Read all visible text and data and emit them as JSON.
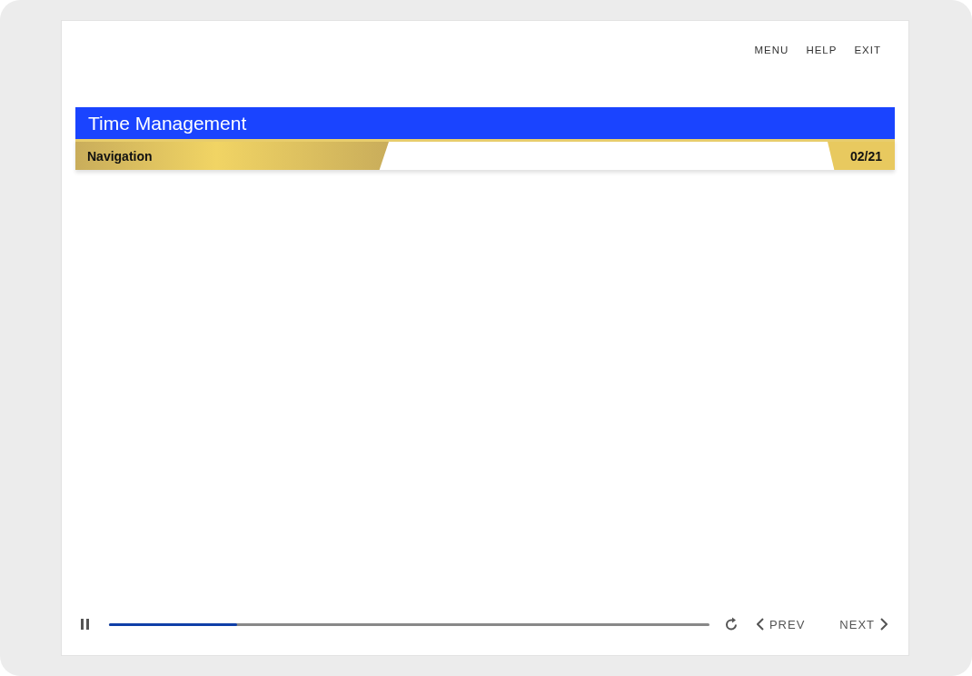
{
  "top_menu": [
    {
      "label": "MENU"
    },
    {
      "label": "HELP"
    },
    {
      "label": "EXIT"
    }
  ],
  "title": "Time Management",
  "section": "Navigation",
  "page_counter": "02/21",
  "player": {
    "playing": true,
    "level": 0.213,
    "prev": "PREV",
    "next": "NEXT"
  }
}
